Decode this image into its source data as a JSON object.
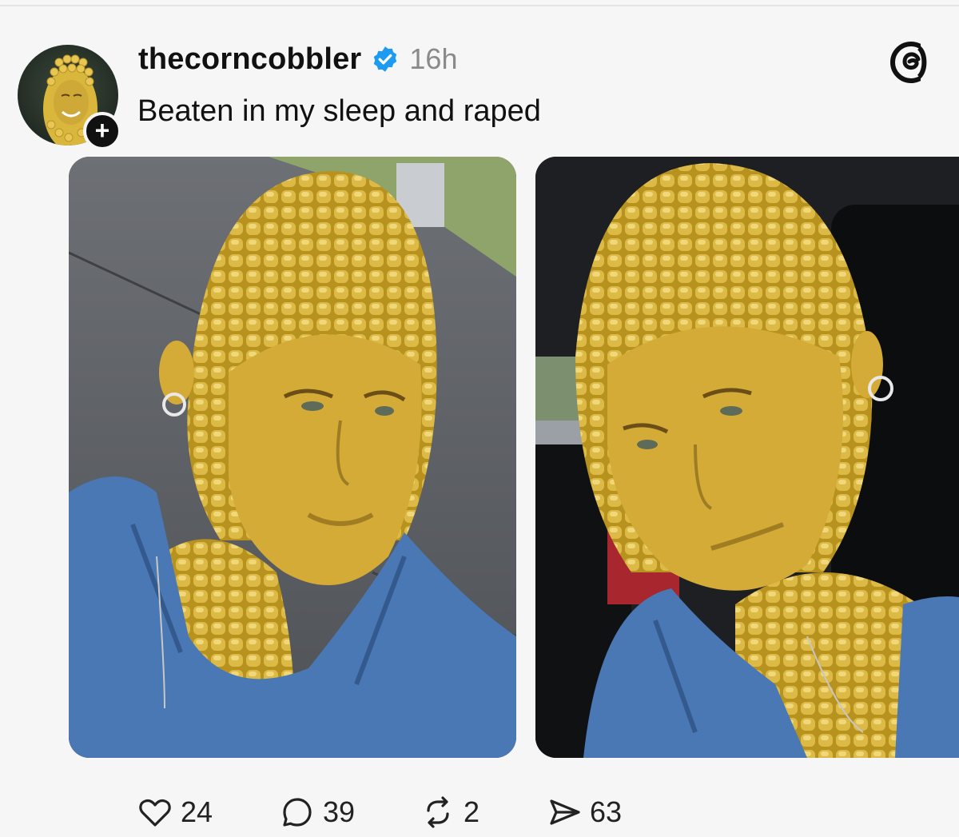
{
  "post": {
    "username": "thecorncobbler",
    "timestamp": "16h",
    "text": "Beaten in my sleep and raped"
  },
  "icons": {
    "verified": "verified-badge-icon",
    "app_logo": "threads-logo-icon",
    "follow": "plus-icon",
    "like": "heart-icon",
    "reply": "speech-bubble-icon",
    "repost": "repost-icon",
    "share": "send-icon"
  },
  "stats": {
    "likes": "24",
    "replies": "39",
    "reposts": "2",
    "shares": "63"
  },
  "colors": {
    "verified_blue": "#1d9bf0",
    "corn_yellow": "#d8b23a",
    "shirt_blue": "#4a78b5"
  }
}
